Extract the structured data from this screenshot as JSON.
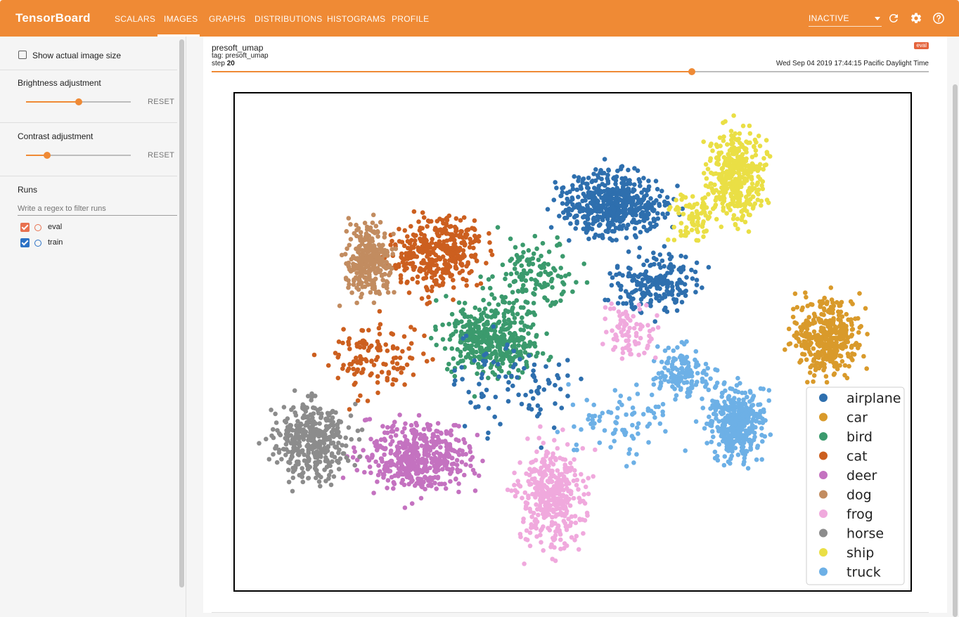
{
  "app": {
    "title": "TensorBoard",
    "tabs": [
      {
        "label": "SCALARS"
      },
      {
        "label": "IMAGES"
      },
      {
        "label": "GRAPHS"
      },
      {
        "label": "DISTRIBUTIONS"
      },
      {
        "label": "HISTOGRAMS"
      },
      {
        "label": "PROFILE"
      }
    ],
    "active_tab": "IMAGES",
    "status": "INACTIVE",
    "accent_color": "#ef8a35",
    "icons": [
      "chevron-down-icon",
      "refresh-icon",
      "gear-icon",
      "help-icon"
    ]
  },
  "sidebar": {
    "show_actual_size": "Show actual image size",
    "show_actual_size_checked": false,
    "brightness": {
      "label": "Brightness adjustment",
      "value": 0.5,
      "reset": "RESET"
    },
    "contrast": {
      "label": "Contrast adjustment",
      "value": 0.2,
      "reset": "RESET"
    },
    "runs": {
      "label": "Runs",
      "filter_placeholder": "Write a regex to filter runs",
      "items": [
        {
          "name": "eval",
          "checked": true,
          "color": "#e8714f"
        },
        {
          "name": "train",
          "checked": true,
          "color": "#2c72c5"
        }
      ]
    }
  },
  "card": {
    "title": "presoft_umap",
    "tag": "tag: presoft_umap",
    "step_label": "step",
    "step_value": "20",
    "timestamp": "Wed Sep 04 2019 17:44:15 Pacific Daylight Time",
    "run_badge": "eval",
    "step_position": 0.67
  },
  "chart_data": {
    "type": "scatter",
    "title": "",
    "legend_position": "bottom-right",
    "series": [
      {
        "name": "airplane",
        "color": "#2e6fae"
      },
      {
        "name": "car",
        "color": "#d99a2b"
      },
      {
        "name": "bird",
        "color": "#3b9a6d"
      },
      {
        "name": "cat",
        "color": "#cc5f1f"
      },
      {
        "name": "deer",
        "color": "#c472c0"
      },
      {
        "name": "dog",
        "color": "#c28c60"
      },
      {
        "name": "frog",
        "color": "#f0a9dd"
      },
      {
        "name": "horse",
        "color": "#8c8c8c"
      },
      {
        "name": "ship",
        "color": "#eadf45"
      },
      {
        "name": "truck",
        "color": "#6db0e6"
      }
    ]
  }
}
